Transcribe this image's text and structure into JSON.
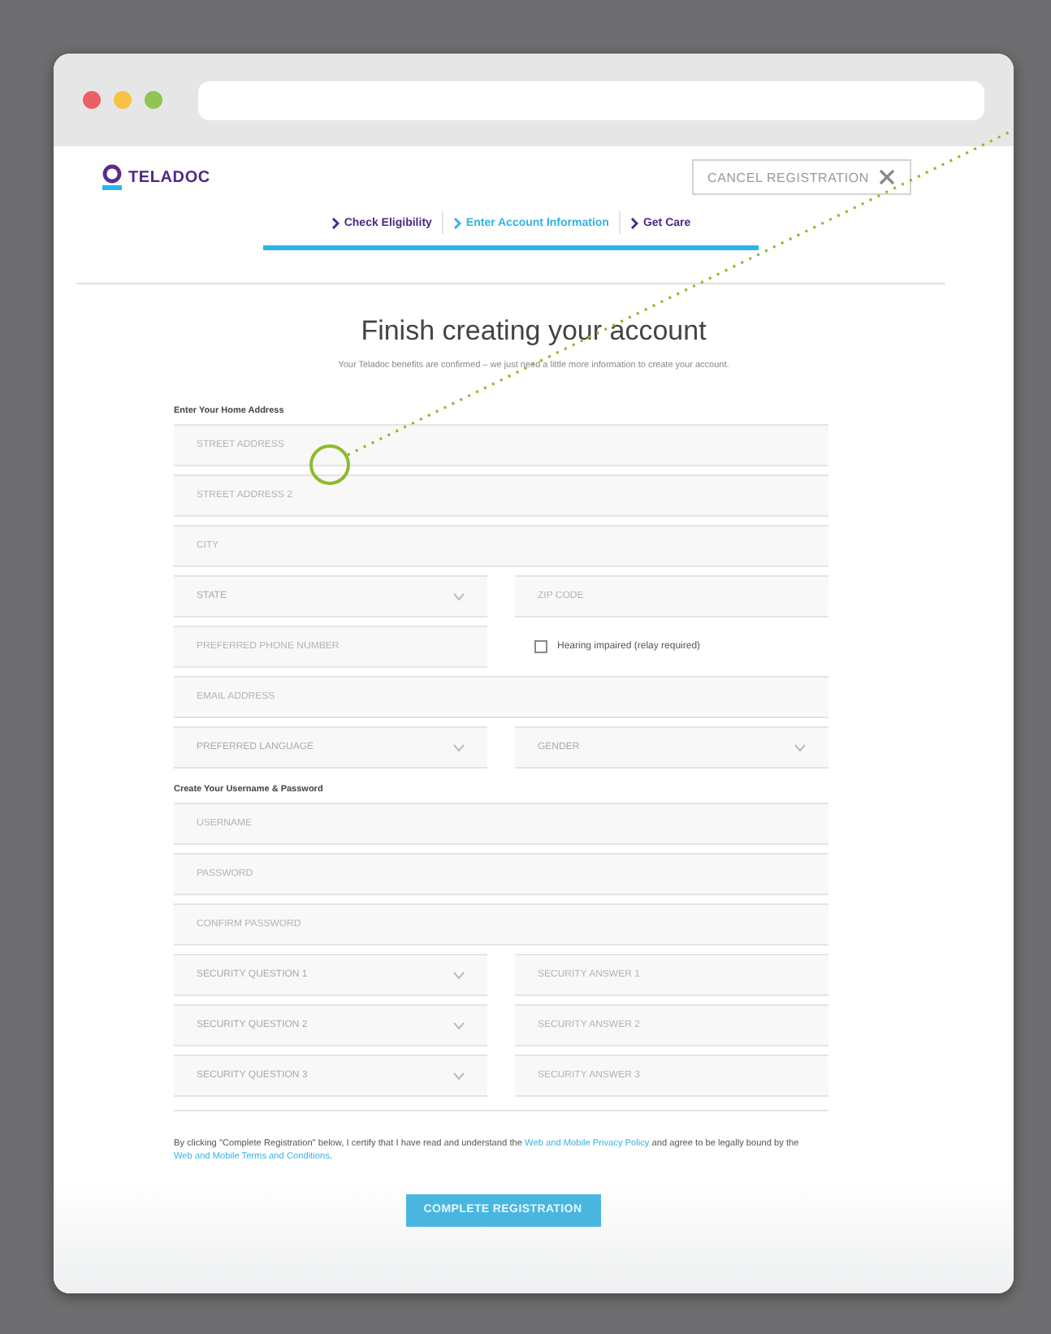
{
  "header": {
    "logo": "TELADOC",
    "cancel_button": "CANCEL REGISTRATION"
  },
  "steps": [
    {
      "label": "Check Eligibility",
      "selected": false
    },
    {
      "label": "Enter Account Information",
      "selected": true
    },
    {
      "label": "Get Care",
      "selected": false
    }
  ],
  "title": "Finish creating your account",
  "subtitle": "Your Teladoc benefits are confirmed – we just need a little more information to create your account.",
  "sections": [
    {
      "heading": "Enter Your Home Address",
      "rows": [
        [
          {
            "kind": "text",
            "placeholder": "STREET ADDRESS"
          }
        ],
        [
          {
            "kind": "text",
            "placeholder": "STREET ADDRESS 2"
          }
        ],
        [
          {
            "kind": "text",
            "placeholder": "CITY"
          }
        ],
        [
          {
            "kind": "select",
            "placeholder": "STATE"
          },
          {
            "kind": "text",
            "placeholder": "ZIP CODE"
          }
        ],
        [
          {
            "kind": "text",
            "placeholder": "PREFERRED PHONE NUMBER"
          },
          {
            "kind": "checkbox",
            "label": "Hearing impaired (relay required)",
            "checked": false
          }
        ],
        [
          {
            "kind": "text",
            "placeholder": "EMAIL ADDRESS"
          }
        ],
        [
          {
            "kind": "select",
            "placeholder": "PREFERRED LANGUAGE"
          },
          {
            "kind": "select",
            "placeholder": "GENDER"
          }
        ]
      ]
    },
    {
      "heading": "Create Your Username & Password",
      "rows": [
        [
          {
            "kind": "text",
            "placeholder": "USERNAME"
          }
        ],
        [
          {
            "kind": "text",
            "placeholder": "PASSWORD"
          }
        ],
        [
          {
            "kind": "text",
            "placeholder": "CONFIRM PASSWORD"
          }
        ],
        [
          {
            "kind": "select",
            "placeholder": "SECURITY QUESTION 1"
          },
          {
            "kind": "text",
            "placeholder": "SECURITY ANSWER 1"
          }
        ],
        [
          {
            "kind": "select",
            "placeholder": "SECURITY QUESTION 2"
          },
          {
            "kind": "text",
            "placeholder": "SECURITY ANSWER 2"
          }
        ],
        [
          {
            "kind": "select",
            "placeholder": "SECURITY QUESTION 3"
          },
          {
            "kind": "text",
            "placeholder": "SECURITY ANSWER 3"
          }
        ]
      ]
    }
  ],
  "legal": [
    {
      "kind": "text",
      "text": "By clicking \"Complete Registration\" below, I certify that I have read and understand the "
    },
    {
      "kind": "link",
      "text": "Web and Mobile Privacy Policy"
    },
    {
      "kind": "text",
      "text": " and agree to be legally bound by the "
    },
    {
      "kind": "link",
      "text": "Web and Mobile Terms and Conditions"
    },
    {
      "kind": "text",
      "text": "."
    }
  ],
  "submit_button": "COMPLETE REGISTRATION"
}
